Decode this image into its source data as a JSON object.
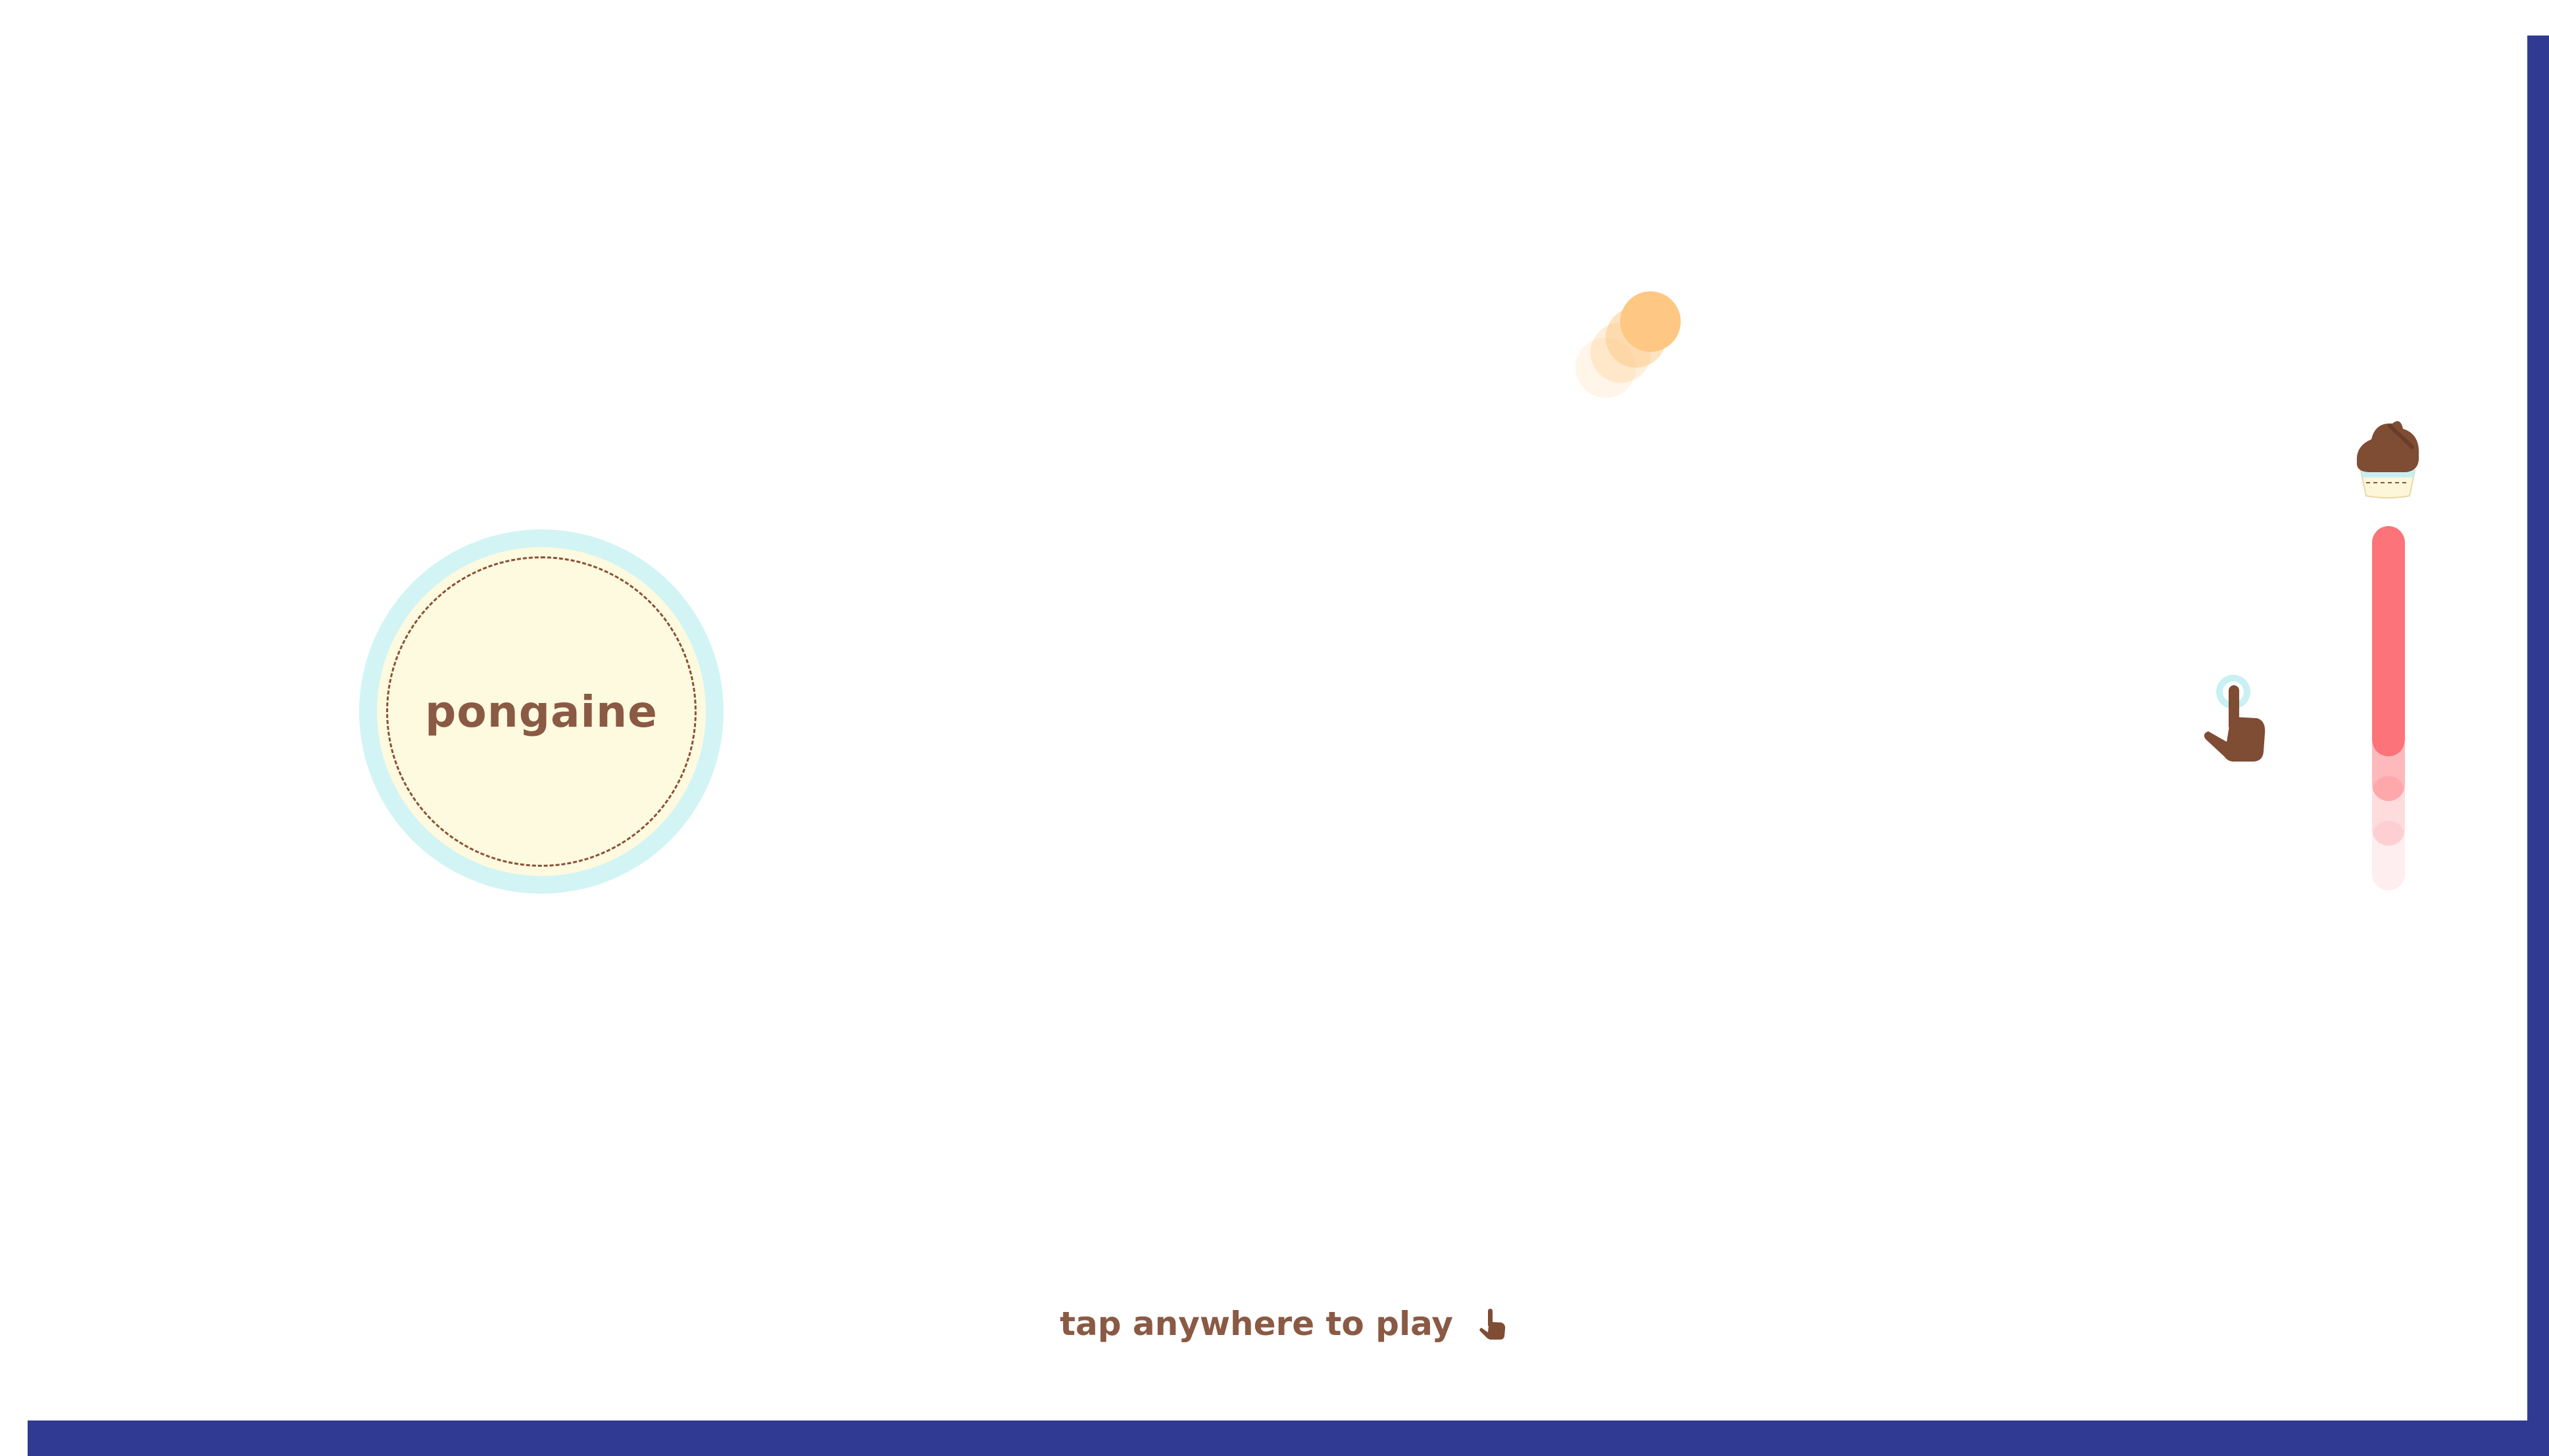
{
  "game": {
    "title": "pongaine",
    "prompt": "tap anywhere to play"
  },
  "icons": {
    "cupcake": "cupcake-icon",
    "tap_hand": "pointing-hand-icon",
    "ball": "ball"
  },
  "colors": {
    "frame": "#313a93",
    "logo_ring": "#d2f4f4",
    "logo_fill": "#fefadf",
    "logo_dash": "#8a5038",
    "text": "#8a5a44",
    "ball": "#fec783",
    "paddle": "#fd737a",
    "hand": "#7f4c34",
    "tap_ring": "#c9f0f3",
    "frosting": "#7f4c34",
    "cup": "#fdf6d8"
  }
}
